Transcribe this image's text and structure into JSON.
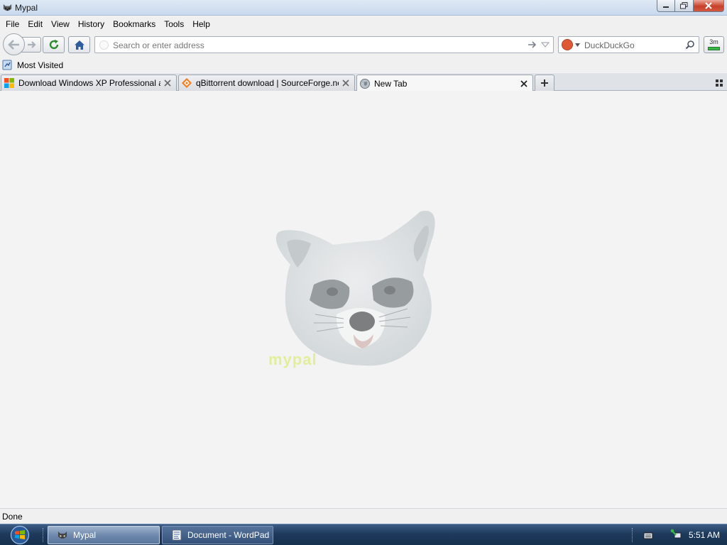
{
  "window": {
    "title": "Mypal"
  },
  "menu": [
    "File",
    "Edit",
    "View",
    "History",
    "Bookmarks",
    "Tools",
    "Help"
  ],
  "navbar": {
    "address_placeholder": "Search or enter address",
    "address_value": "",
    "search_placeholder": "DuckDuckGo",
    "search_engine_icon": "duckduckgo-icon",
    "addon_label": "3m"
  },
  "bookmarks": {
    "items": [
      {
        "label": "Most Visited",
        "icon": "bookmarks-folder-icon"
      }
    ]
  },
  "tabs": [
    {
      "label": "Download Windows XP Professional a...",
      "icon": "windows-logo-icon",
      "selected": false
    },
    {
      "label": "qBittorrent download | SourceForge.net",
      "icon": "sourceforge-icon",
      "selected": false
    },
    {
      "label": "New Tab",
      "icon": "globe-icon",
      "selected": true
    }
  ],
  "content": {
    "mascot_icon": "raccoon-logo-icon",
    "mascot_text": "mypal"
  },
  "status": {
    "text": "Done"
  },
  "taskbar": {
    "buttons": [
      {
        "label": "Mypal",
        "icon": "mypal-icon",
        "active": true
      },
      {
        "label": "Document - WordPad",
        "icon": "wordpad-icon",
        "active": false
      }
    ],
    "clock": "5:51 AM"
  },
  "colors": {
    "content_bg": "#f3f3f3",
    "taskbar_bg": "#1e3a5c",
    "duckduckgo": "#de5833"
  }
}
